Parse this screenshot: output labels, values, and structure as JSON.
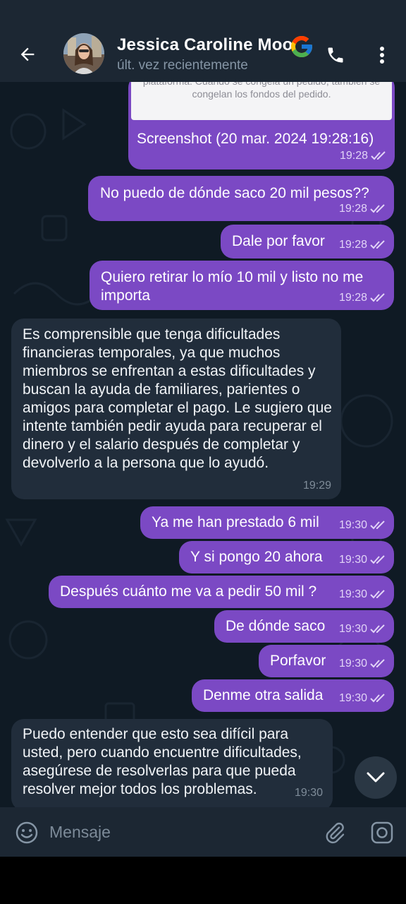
{
  "header": {
    "contact_name": "Jessica Caroline Moo",
    "status": "últ. vez recientemente"
  },
  "colors": {
    "outgoing_bubble": "#7b49c4",
    "incoming_bubble": "#212d3b",
    "header_bg": "#1c2733"
  },
  "messages": [
    {
      "id": "m0",
      "dir": "out",
      "preview_text": "plataforma. Cuando se congela un pedido, también se congelan los fondos del pedido.",
      "text": "Screenshot (20 mar. 2024 19:28:16)",
      "time": "19:28"
    },
    {
      "id": "m1",
      "dir": "out",
      "text": "No puedo de dónde saco 20 mil pesos??",
      "time": "19:28"
    },
    {
      "id": "m2",
      "dir": "out",
      "text": "Dale por favor",
      "time": "19:28"
    },
    {
      "id": "m3",
      "dir": "out",
      "text": "Quiero retirar lo mío 10 mil y listo no me importa",
      "time": "19:28"
    },
    {
      "id": "m4",
      "dir": "in",
      "text": "Es comprensible que tenga dificultades financieras temporales, ya que muchos miembros se enfrentan a estas dificultades y buscan la ayuda de familiares, parientes o amigos para completar el pago. Le sugiero que intente también pedir ayuda para recuperar el dinero y el salario después de completar y devolverlo a la persona que lo ayudó.",
      "time": "19:29"
    },
    {
      "id": "m5",
      "dir": "out",
      "text": "Ya me han prestado 6 mil",
      "time": "19:30"
    },
    {
      "id": "m6",
      "dir": "out",
      "text": "Y si pongo 20 ahora",
      "time": "19:30"
    },
    {
      "id": "m7",
      "dir": "out",
      "text": "Después cuánto me va a pedir 50 mil ?",
      "time": "19:30"
    },
    {
      "id": "m8",
      "dir": "out",
      "text": "De dónde saco",
      "time": "19:30"
    },
    {
      "id": "m9",
      "dir": "out",
      "text": "Porfavor",
      "time": "19:30"
    },
    {
      "id": "m10",
      "dir": "out",
      "text": "Denme otra salida",
      "time": "19:30"
    },
    {
      "id": "m11",
      "dir": "in",
      "text": "Puedo entender que esto sea difícil para usted, pero cuando encuentre dificultades, asegúrese de resolverlas para que pueda resolver mejor todos los problemas.",
      "time": "19:30"
    }
  ],
  "composer": {
    "placeholder": "Mensaje"
  },
  "icons": [
    "back-arrow-icon",
    "google-icon",
    "phone-icon",
    "more-vert-icon",
    "double-check-icon",
    "chevron-down-icon",
    "emoji-icon",
    "paperclip-icon",
    "camera-icon"
  ]
}
